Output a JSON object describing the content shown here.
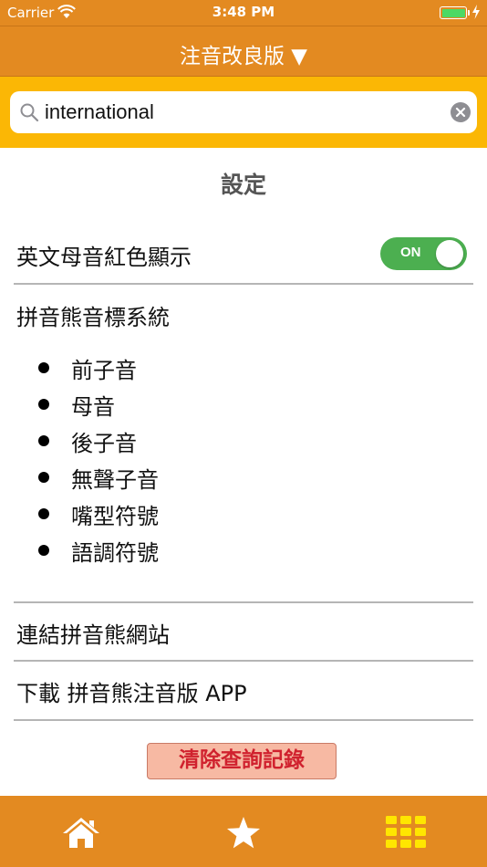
{
  "status_bar": {
    "carrier": "Carrier",
    "time": "3:48 PM"
  },
  "nav": {
    "title": "注音改良版 ▼"
  },
  "search": {
    "value": "international"
  },
  "settings": {
    "title": "設定",
    "vowel_red_label": "英文母音紅色顯示",
    "toggle_label": "ON",
    "system_label": "拼音熊音標系統",
    "system_items": [
      "前子音",
      "母音",
      "後子音",
      "無聲子音",
      "嘴型符號",
      "語調符號"
    ],
    "link_label": "連結拼音熊網站",
    "download_label": "下載 拼音熊注音版 APP",
    "clear_history_label": "清除查詢記錄"
  },
  "colors": {
    "accent": "#E38A21",
    "search_bg": "#FBB705",
    "toggle_on": "#4CAF50",
    "battery": "#4CD964",
    "clear_btn_text": "#D0212E"
  },
  "tabs": [
    {
      "icon": "home-icon"
    },
    {
      "icon": "star-icon"
    },
    {
      "icon": "grid-icon"
    }
  ]
}
